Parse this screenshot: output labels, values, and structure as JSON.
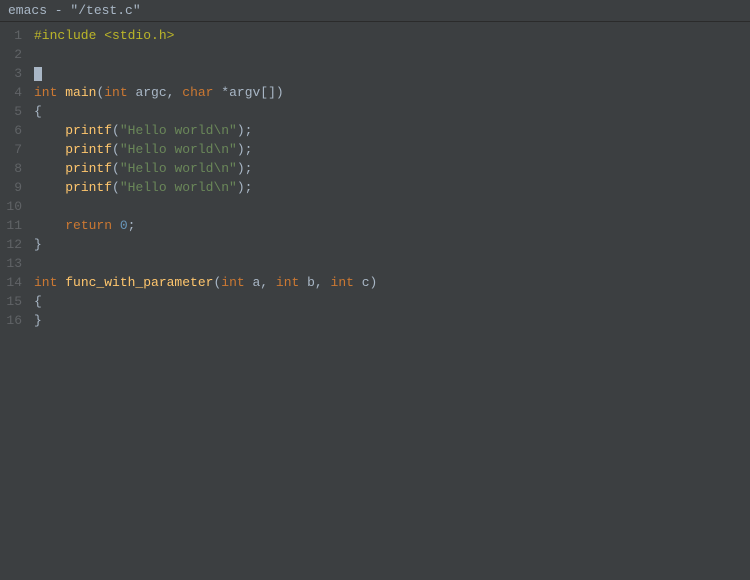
{
  "titlebar": {
    "text": "emacs - \"/test.c\""
  },
  "lines": [
    {
      "num": 1,
      "content": "#include <stdio.h>",
      "type": "preprocessor"
    },
    {
      "num": 2,
      "content": "",
      "type": "empty"
    },
    {
      "num": 3,
      "content": "[]",
      "type": "cursor"
    },
    {
      "num": 4,
      "content": "int main(int argc, char *argv[])",
      "type": "code"
    },
    {
      "num": 5,
      "content": "{",
      "type": "code"
    },
    {
      "num": 6,
      "content": "    printf(\"Hello world\\n\");",
      "type": "code"
    },
    {
      "num": 7,
      "content": "    printf(\"Hello world\\n\");",
      "type": "code"
    },
    {
      "num": 8,
      "content": "    printf(\"Hello world\\n\");",
      "type": "code"
    },
    {
      "num": 9,
      "content": "    printf(\"Hello world\\n\");",
      "type": "code"
    },
    {
      "num": 10,
      "content": "",
      "type": "empty"
    },
    {
      "num": 11,
      "content": "    return 0;",
      "type": "code"
    },
    {
      "num": 12,
      "content": "}",
      "type": "code"
    },
    {
      "num": 13,
      "content": "",
      "type": "empty"
    },
    {
      "num": 14,
      "content": "int func_with_parameter(int a, int b, int c)",
      "type": "code"
    },
    {
      "num": 15,
      "content": "{",
      "type": "code"
    },
    {
      "num": 16,
      "content": "}",
      "type": "code"
    }
  ]
}
